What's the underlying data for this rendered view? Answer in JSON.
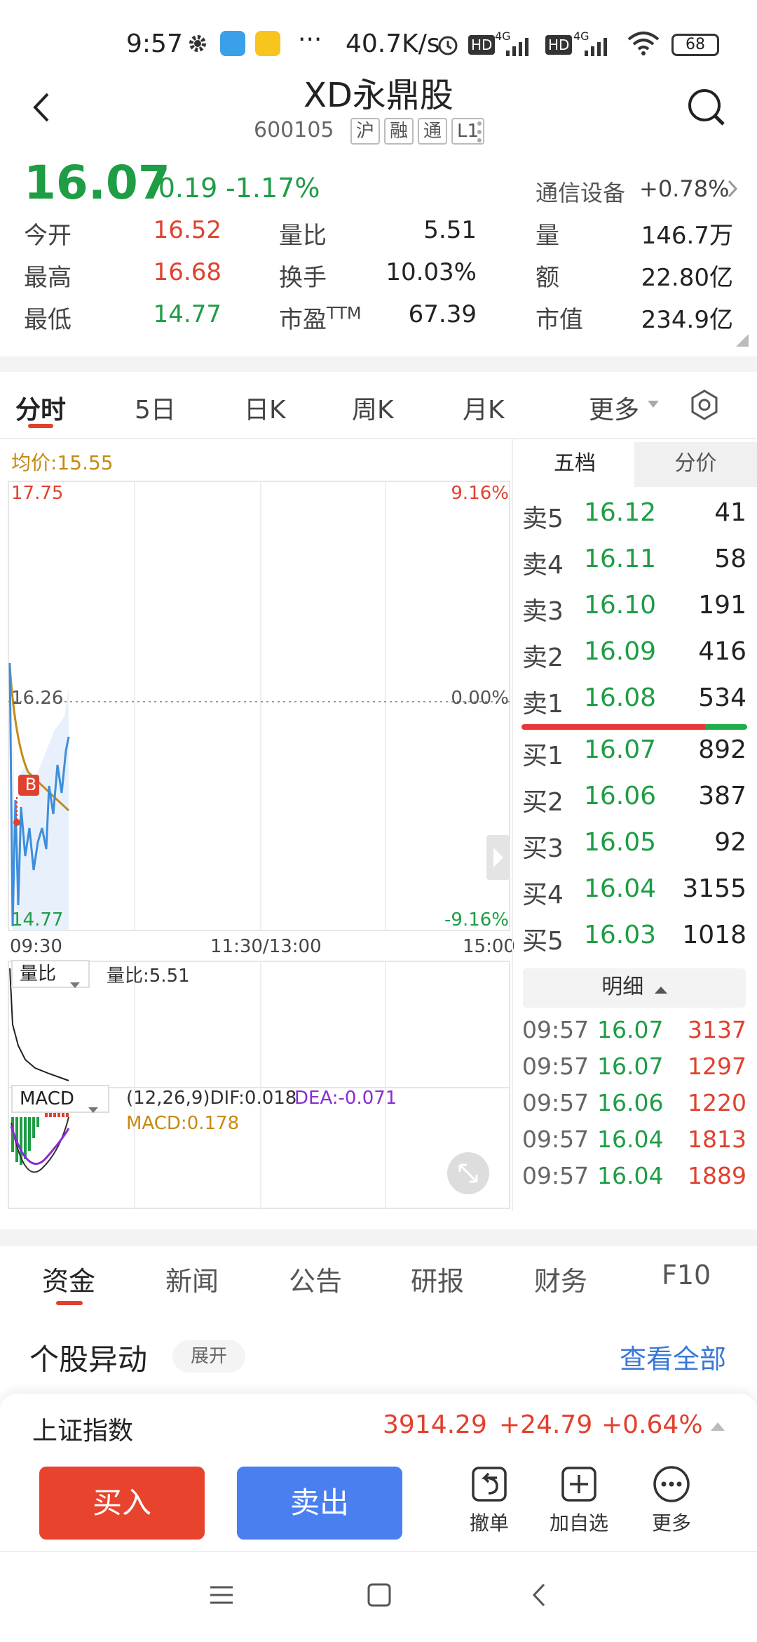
{
  "status_bar": {
    "time": "9:57",
    "net_speed": "40.7K/s",
    "battery": "68",
    "dots": "···",
    "hd1": "HD",
    "hd2": "HD",
    "sig1": "4G",
    "sig2": "4G"
  },
  "header": {
    "title": "XD永鼎股",
    "code": "600105",
    "tags": [
      "沪",
      "融",
      "通",
      "L1"
    ]
  },
  "quote": {
    "price": "16.07",
    "change": "-0.19",
    "change_pct": "-1.17%",
    "sector_name": "通信设备",
    "sector_change": "+0.78%",
    "rows": [
      {
        "l1": "今开",
        "v1": "16.52",
        "l2": "量比",
        "v2": "5.51",
        "l3": "量",
        "v3": "146.7万"
      },
      {
        "l1": "最高",
        "v1": "16.68",
        "l2": "换手",
        "v2": "10.03%",
        "l3": "额",
        "v3": "22.80亿"
      },
      {
        "l1": "最低",
        "v1": "14.77",
        "l2": "市盈",
        "l2_sup": "TTM",
        "v2": "67.39",
        "l3": "市值",
        "v3": "234.9亿"
      }
    ]
  },
  "chart_tabs": [
    "分时",
    "5日",
    "日K",
    "周K",
    "月K",
    "更多"
  ],
  "chart": {
    "avg_label": "均价:15.55",
    "y_top": "17.75",
    "y_mid": "16.26",
    "y_bottom": "14.77",
    "pct_top": "9.16%",
    "pct_mid": "0.00%",
    "pct_bottom": "-9.16%",
    "x_start": "09:30",
    "x_mid": "11:30/13:00",
    "x_end": "15:00",
    "b_marker": "B",
    "vol_selector": "量比",
    "vol_label": "量比:5.51",
    "macd_selector": "MACD",
    "macd_params": "(12,26,9)DIF:0.018",
    "macd_dea": "DEA:-0.071",
    "macd_value": "MACD:0.178"
  },
  "order_book": {
    "tabs": [
      "五档",
      "分价"
    ],
    "sells": [
      {
        "label": "卖5",
        "price": "16.12",
        "vol": "41"
      },
      {
        "label": "卖4",
        "price": "16.11",
        "vol": "58"
      },
      {
        "label": "卖3",
        "price": "16.10",
        "vol": "191"
      },
      {
        "label": "卖2",
        "price": "16.09",
        "vol": "416"
      },
      {
        "label": "卖1",
        "price": "16.08",
        "vol": "534"
      }
    ],
    "buys": [
      {
        "label": "买1",
        "price": "16.07",
        "vol": "892"
      },
      {
        "label": "买2",
        "price": "16.06",
        "vol": "387"
      },
      {
        "label": "买3",
        "price": "16.05",
        "vol": "92"
      },
      {
        "label": "买4",
        "price": "16.04",
        "vol": "3155"
      },
      {
        "label": "买5",
        "price": "16.03",
        "vol": "1018"
      }
    ],
    "detail_label": "明细",
    "ticks": [
      {
        "time": "09:57",
        "price": "16.07",
        "vol": "3137"
      },
      {
        "time": "09:57",
        "price": "16.07",
        "vol": "1297"
      },
      {
        "time": "09:57",
        "price": "16.06",
        "vol": "1220"
      },
      {
        "time": "09:57",
        "price": "16.04",
        "vol": "1813"
      },
      {
        "time": "09:57",
        "price": "16.04",
        "vol": "1889"
      }
    ]
  },
  "bottom_tabs": [
    "资金",
    "新闻",
    "公告",
    "研报",
    "财务",
    "F10"
  ],
  "movement": {
    "title": "个股异动",
    "expand": "展开",
    "view_all": "查看全部"
  },
  "index_bar": {
    "name": "上证指数",
    "value": "3914.29",
    "change": "+24.79",
    "pct": "+0.64%"
  },
  "actions": {
    "buy": "买入",
    "sell": "卖出",
    "cancel": "撤单",
    "add_watch": "加自选",
    "more": "更多"
  },
  "colors": {
    "up": "#e0412f",
    "down": "#1e9d45",
    "buy_btn": "#e8432c",
    "sell_btn": "#4a7ff0",
    "link": "#3a78d6"
  }
}
